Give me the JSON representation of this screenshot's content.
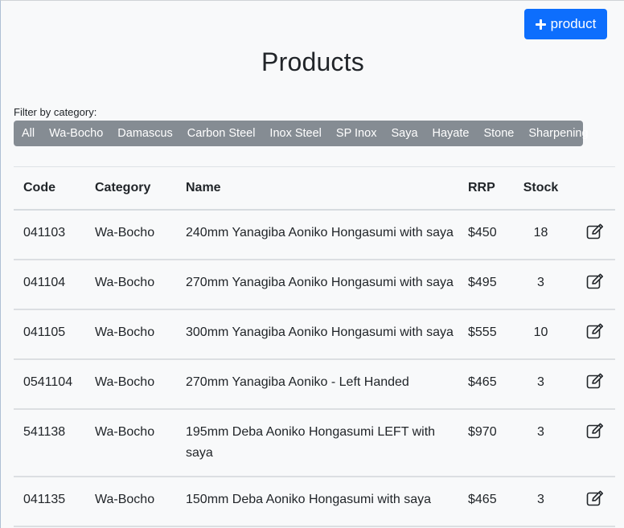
{
  "toolbar": {
    "add_label": "product",
    "add_icon": "plus-icon"
  },
  "page": {
    "title": "Products"
  },
  "filter": {
    "label": "Filter by category:",
    "items": [
      "All",
      "Wa-Bocho",
      "Damascus",
      "Carbon Steel",
      "Inox Steel",
      "SP Inox",
      "Saya",
      "Hayate",
      "Stone",
      "Sharpening"
    ]
  },
  "table": {
    "headers": {
      "code": "Code",
      "category": "Category",
      "name": "Name",
      "rrp": "RRP",
      "stock": "Stock"
    },
    "rows": [
      {
        "code": "041103",
        "category": "Wa-Bocho",
        "name": "240mm Yanagiba Aoniko Hongasumi with saya",
        "rrp": "$450",
        "stock": "18"
      },
      {
        "code": "041104",
        "category": "Wa-Bocho",
        "name": "270mm Yanagiba Aoniko Hongasumi with saya",
        "rrp": "$495",
        "stock": "3"
      },
      {
        "code": "041105",
        "category": "Wa-Bocho",
        "name": "300mm Yanagiba Aoniko Hongasumi with saya",
        "rrp": "$555",
        "stock": "10"
      },
      {
        "code": "0541104",
        "category": "Wa-Bocho",
        "name": "270mm Yanagiba Aoniko - Left Handed",
        "rrp": "$465",
        "stock": "3"
      },
      {
        "code": "541138",
        "category": "Wa-Bocho",
        "name": "195mm Deba Aoniko Hongasumi LEFT with saya",
        "rrp": "$970",
        "stock": "3"
      },
      {
        "code": "041135",
        "category": "Wa-Bocho",
        "name": "150mm Deba Aoniko Hongasumi with saya",
        "rrp": "$465",
        "stock": "3"
      }
    ],
    "edit_icon": "edit-icon"
  },
  "colors": {
    "primary": "#0d6efd",
    "filter_bg": "#858c93",
    "page_bg": "#f8f9fa"
  }
}
